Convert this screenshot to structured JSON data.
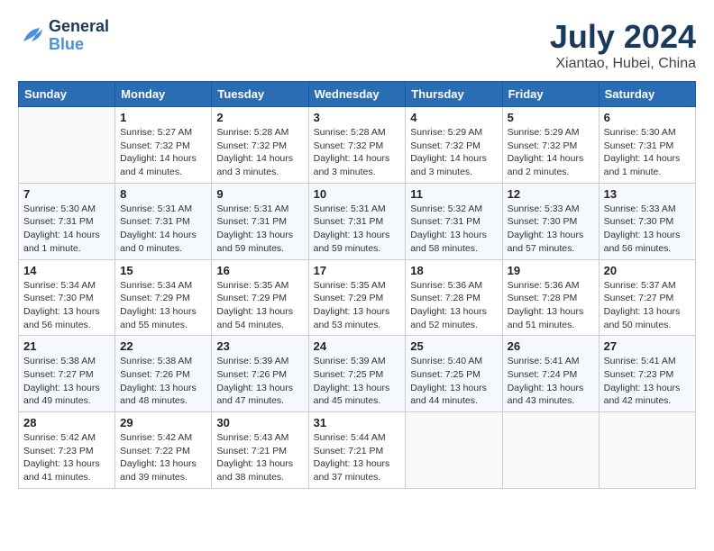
{
  "header": {
    "logo_text_general": "General",
    "logo_text_blue": "Blue",
    "month_year": "July 2024",
    "location": "Xiantao, Hubei, China"
  },
  "weekdays": [
    "Sunday",
    "Monday",
    "Tuesday",
    "Wednesday",
    "Thursday",
    "Friday",
    "Saturday"
  ],
  "weeks": [
    [
      {
        "day": "",
        "sunrise": "",
        "sunset": "",
        "daylight": ""
      },
      {
        "day": "1",
        "sunrise": "5:27 AM",
        "sunset": "7:32 PM",
        "daylight": "14 hours and 4 minutes."
      },
      {
        "day": "2",
        "sunrise": "5:28 AM",
        "sunset": "7:32 PM",
        "daylight": "14 hours and 3 minutes."
      },
      {
        "day": "3",
        "sunrise": "5:28 AM",
        "sunset": "7:32 PM",
        "daylight": "14 hours and 3 minutes."
      },
      {
        "day": "4",
        "sunrise": "5:29 AM",
        "sunset": "7:32 PM",
        "daylight": "14 hours and 3 minutes."
      },
      {
        "day": "5",
        "sunrise": "5:29 AM",
        "sunset": "7:32 PM",
        "daylight": "14 hours and 2 minutes."
      },
      {
        "day": "6",
        "sunrise": "5:30 AM",
        "sunset": "7:31 PM",
        "daylight": "14 hours and 1 minute."
      }
    ],
    [
      {
        "day": "7",
        "sunrise": "5:30 AM",
        "sunset": "7:31 PM",
        "daylight": "14 hours and 1 minute."
      },
      {
        "day": "8",
        "sunrise": "5:31 AM",
        "sunset": "7:31 PM",
        "daylight": "14 hours and 0 minutes."
      },
      {
        "day": "9",
        "sunrise": "5:31 AM",
        "sunset": "7:31 PM",
        "daylight": "13 hours and 59 minutes."
      },
      {
        "day": "10",
        "sunrise": "5:31 AM",
        "sunset": "7:31 PM",
        "daylight": "13 hours and 59 minutes."
      },
      {
        "day": "11",
        "sunrise": "5:32 AM",
        "sunset": "7:31 PM",
        "daylight": "13 hours and 58 minutes."
      },
      {
        "day": "12",
        "sunrise": "5:33 AM",
        "sunset": "7:30 PM",
        "daylight": "13 hours and 57 minutes."
      },
      {
        "day": "13",
        "sunrise": "5:33 AM",
        "sunset": "7:30 PM",
        "daylight": "13 hours and 56 minutes."
      }
    ],
    [
      {
        "day": "14",
        "sunrise": "5:34 AM",
        "sunset": "7:30 PM",
        "daylight": "13 hours and 56 minutes."
      },
      {
        "day": "15",
        "sunrise": "5:34 AM",
        "sunset": "7:29 PM",
        "daylight": "13 hours and 55 minutes."
      },
      {
        "day": "16",
        "sunrise": "5:35 AM",
        "sunset": "7:29 PM",
        "daylight": "13 hours and 54 minutes."
      },
      {
        "day": "17",
        "sunrise": "5:35 AM",
        "sunset": "7:29 PM",
        "daylight": "13 hours and 53 minutes."
      },
      {
        "day": "18",
        "sunrise": "5:36 AM",
        "sunset": "7:28 PM",
        "daylight": "13 hours and 52 minutes."
      },
      {
        "day": "19",
        "sunrise": "5:36 AM",
        "sunset": "7:28 PM",
        "daylight": "13 hours and 51 minutes."
      },
      {
        "day": "20",
        "sunrise": "5:37 AM",
        "sunset": "7:27 PM",
        "daylight": "13 hours and 50 minutes."
      }
    ],
    [
      {
        "day": "21",
        "sunrise": "5:38 AM",
        "sunset": "7:27 PM",
        "daylight": "13 hours and 49 minutes."
      },
      {
        "day": "22",
        "sunrise": "5:38 AM",
        "sunset": "7:26 PM",
        "daylight": "13 hours and 48 minutes."
      },
      {
        "day": "23",
        "sunrise": "5:39 AM",
        "sunset": "7:26 PM",
        "daylight": "13 hours and 47 minutes."
      },
      {
        "day": "24",
        "sunrise": "5:39 AM",
        "sunset": "7:25 PM",
        "daylight": "13 hours and 45 minutes."
      },
      {
        "day": "25",
        "sunrise": "5:40 AM",
        "sunset": "7:25 PM",
        "daylight": "13 hours and 44 minutes."
      },
      {
        "day": "26",
        "sunrise": "5:41 AM",
        "sunset": "7:24 PM",
        "daylight": "13 hours and 43 minutes."
      },
      {
        "day": "27",
        "sunrise": "5:41 AM",
        "sunset": "7:23 PM",
        "daylight": "13 hours and 42 minutes."
      }
    ],
    [
      {
        "day": "28",
        "sunrise": "5:42 AM",
        "sunset": "7:23 PM",
        "daylight": "13 hours and 41 minutes."
      },
      {
        "day": "29",
        "sunrise": "5:42 AM",
        "sunset": "7:22 PM",
        "daylight": "13 hours and 39 minutes."
      },
      {
        "day": "30",
        "sunrise": "5:43 AM",
        "sunset": "7:21 PM",
        "daylight": "13 hours and 38 minutes."
      },
      {
        "day": "31",
        "sunrise": "5:44 AM",
        "sunset": "7:21 PM",
        "daylight": "13 hours and 37 minutes."
      },
      {
        "day": "",
        "sunrise": "",
        "sunset": "",
        "daylight": ""
      },
      {
        "day": "",
        "sunrise": "",
        "sunset": "",
        "daylight": ""
      },
      {
        "day": "",
        "sunrise": "",
        "sunset": "",
        "daylight": ""
      }
    ]
  ]
}
